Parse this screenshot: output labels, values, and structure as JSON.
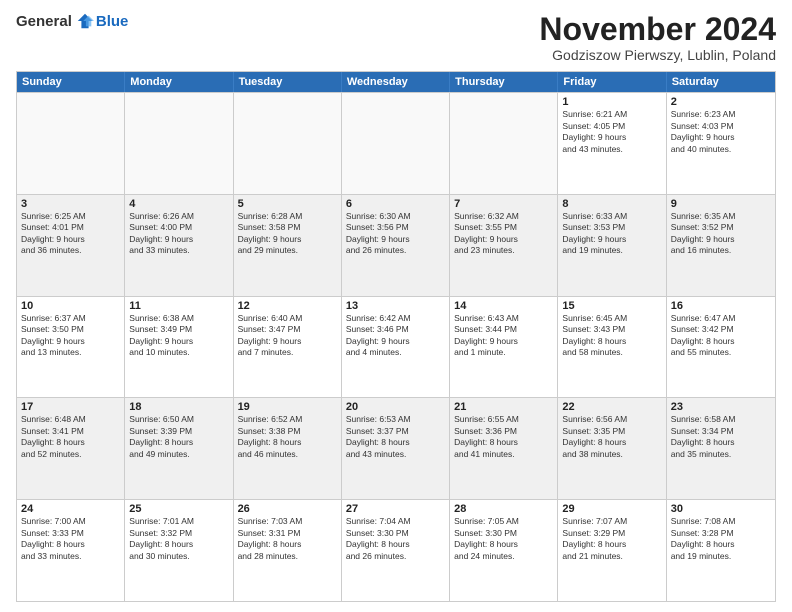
{
  "logo": {
    "general": "General",
    "blue": "Blue"
  },
  "title": "November 2024",
  "subtitle": "Godziszow Pierwszy, Lublin, Poland",
  "days_of_week": [
    "Sunday",
    "Monday",
    "Tuesday",
    "Wednesday",
    "Thursday",
    "Friday",
    "Saturday"
  ],
  "weeks": [
    [
      {
        "day": "",
        "info": ""
      },
      {
        "day": "",
        "info": ""
      },
      {
        "day": "",
        "info": ""
      },
      {
        "day": "",
        "info": ""
      },
      {
        "day": "",
        "info": ""
      },
      {
        "day": "1",
        "info": "Sunrise: 6:21 AM\nSunset: 4:05 PM\nDaylight: 9 hours\nand 43 minutes."
      },
      {
        "day": "2",
        "info": "Sunrise: 6:23 AM\nSunset: 4:03 PM\nDaylight: 9 hours\nand 40 minutes."
      }
    ],
    [
      {
        "day": "3",
        "info": "Sunrise: 6:25 AM\nSunset: 4:01 PM\nDaylight: 9 hours\nand 36 minutes."
      },
      {
        "day": "4",
        "info": "Sunrise: 6:26 AM\nSunset: 4:00 PM\nDaylight: 9 hours\nand 33 minutes."
      },
      {
        "day": "5",
        "info": "Sunrise: 6:28 AM\nSunset: 3:58 PM\nDaylight: 9 hours\nand 29 minutes."
      },
      {
        "day": "6",
        "info": "Sunrise: 6:30 AM\nSunset: 3:56 PM\nDaylight: 9 hours\nand 26 minutes."
      },
      {
        "day": "7",
        "info": "Sunrise: 6:32 AM\nSunset: 3:55 PM\nDaylight: 9 hours\nand 23 minutes."
      },
      {
        "day": "8",
        "info": "Sunrise: 6:33 AM\nSunset: 3:53 PM\nDaylight: 9 hours\nand 19 minutes."
      },
      {
        "day": "9",
        "info": "Sunrise: 6:35 AM\nSunset: 3:52 PM\nDaylight: 9 hours\nand 16 minutes."
      }
    ],
    [
      {
        "day": "10",
        "info": "Sunrise: 6:37 AM\nSunset: 3:50 PM\nDaylight: 9 hours\nand 13 minutes."
      },
      {
        "day": "11",
        "info": "Sunrise: 6:38 AM\nSunset: 3:49 PM\nDaylight: 9 hours\nand 10 minutes."
      },
      {
        "day": "12",
        "info": "Sunrise: 6:40 AM\nSunset: 3:47 PM\nDaylight: 9 hours\nand 7 minutes."
      },
      {
        "day": "13",
        "info": "Sunrise: 6:42 AM\nSunset: 3:46 PM\nDaylight: 9 hours\nand 4 minutes."
      },
      {
        "day": "14",
        "info": "Sunrise: 6:43 AM\nSunset: 3:44 PM\nDaylight: 9 hours\nand 1 minute."
      },
      {
        "day": "15",
        "info": "Sunrise: 6:45 AM\nSunset: 3:43 PM\nDaylight: 8 hours\nand 58 minutes."
      },
      {
        "day": "16",
        "info": "Sunrise: 6:47 AM\nSunset: 3:42 PM\nDaylight: 8 hours\nand 55 minutes."
      }
    ],
    [
      {
        "day": "17",
        "info": "Sunrise: 6:48 AM\nSunset: 3:41 PM\nDaylight: 8 hours\nand 52 minutes."
      },
      {
        "day": "18",
        "info": "Sunrise: 6:50 AM\nSunset: 3:39 PM\nDaylight: 8 hours\nand 49 minutes."
      },
      {
        "day": "19",
        "info": "Sunrise: 6:52 AM\nSunset: 3:38 PM\nDaylight: 8 hours\nand 46 minutes."
      },
      {
        "day": "20",
        "info": "Sunrise: 6:53 AM\nSunset: 3:37 PM\nDaylight: 8 hours\nand 43 minutes."
      },
      {
        "day": "21",
        "info": "Sunrise: 6:55 AM\nSunset: 3:36 PM\nDaylight: 8 hours\nand 41 minutes."
      },
      {
        "day": "22",
        "info": "Sunrise: 6:56 AM\nSunset: 3:35 PM\nDaylight: 8 hours\nand 38 minutes."
      },
      {
        "day": "23",
        "info": "Sunrise: 6:58 AM\nSunset: 3:34 PM\nDaylight: 8 hours\nand 35 minutes."
      }
    ],
    [
      {
        "day": "24",
        "info": "Sunrise: 7:00 AM\nSunset: 3:33 PM\nDaylight: 8 hours\nand 33 minutes."
      },
      {
        "day": "25",
        "info": "Sunrise: 7:01 AM\nSunset: 3:32 PM\nDaylight: 8 hours\nand 30 minutes."
      },
      {
        "day": "26",
        "info": "Sunrise: 7:03 AM\nSunset: 3:31 PM\nDaylight: 8 hours\nand 28 minutes."
      },
      {
        "day": "27",
        "info": "Sunrise: 7:04 AM\nSunset: 3:30 PM\nDaylight: 8 hours\nand 26 minutes."
      },
      {
        "day": "28",
        "info": "Sunrise: 7:05 AM\nSunset: 3:30 PM\nDaylight: 8 hours\nand 24 minutes."
      },
      {
        "day": "29",
        "info": "Sunrise: 7:07 AM\nSunset: 3:29 PM\nDaylight: 8 hours\nand 21 minutes."
      },
      {
        "day": "30",
        "info": "Sunrise: 7:08 AM\nSunset: 3:28 PM\nDaylight: 8 hours\nand 19 minutes."
      }
    ]
  ]
}
